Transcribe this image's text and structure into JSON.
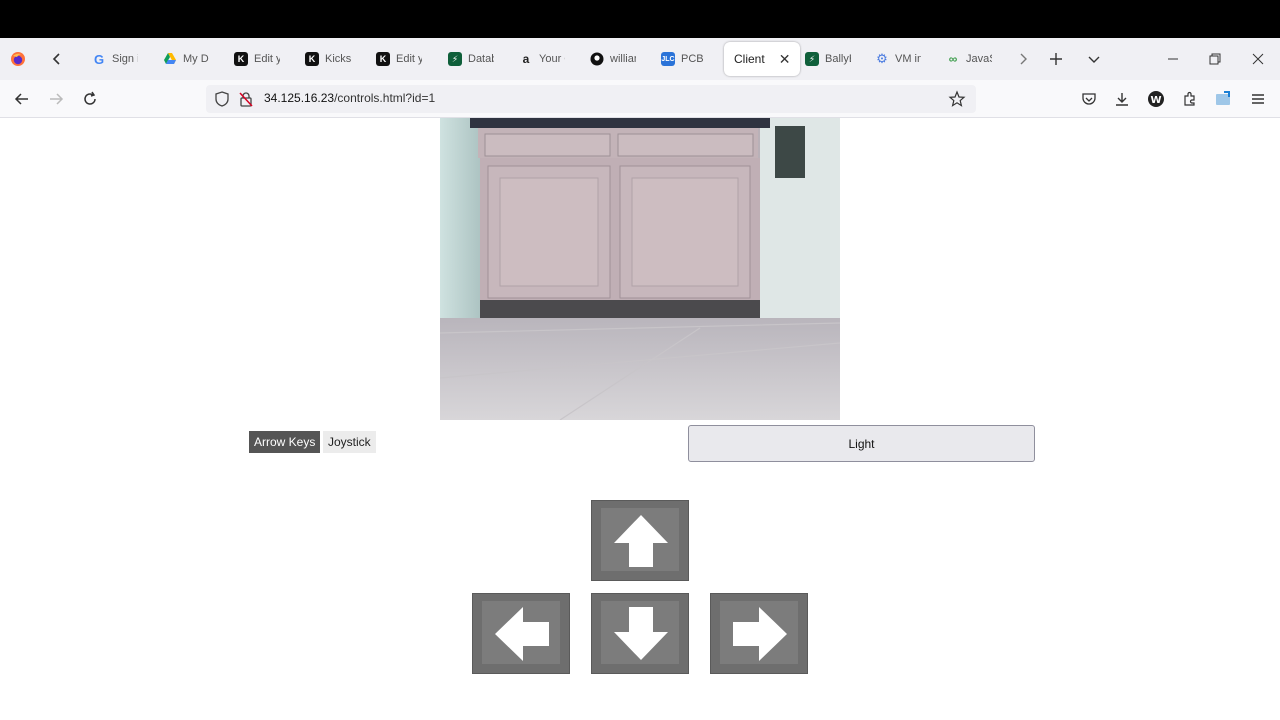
{
  "tabs": [
    {
      "label": "Sign i",
      "icon": "google-icon",
      "color": "#4285f4"
    },
    {
      "label": "My Dr",
      "icon": "google-drive-icon",
      "color": "#1fa463"
    },
    {
      "label": "Edit y",
      "icon": "kickstarter-icon",
      "color": "#111111"
    },
    {
      "label": "Kickst",
      "icon": "kickstarter-icon",
      "color": "#111111"
    },
    {
      "label": "Edit y",
      "icon": "kickstarter-icon",
      "color": "#111111"
    },
    {
      "label": "Datab",
      "icon": "database-icon",
      "color": "#0f5f3a"
    },
    {
      "label": "Your C",
      "icon": "amazon-icon",
      "color": "#ff9900"
    },
    {
      "label": "willian",
      "icon": "github-icon",
      "color": "#111111"
    },
    {
      "label": "PCB P",
      "icon": "jlc-icon",
      "color": "#2a73d8"
    },
    {
      "label": "Client",
      "icon": "",
      "color": "#ffffff",
      "active": true
    },
    {
      "label": "BallyE",
      "icon": "database-icon",
      "color": "#0f5f3a"
    },
    {
      "label": "VM in",
      "icon": "gear-icon",
      "color": "#4a7be0"
    },
    {
      "label": "JavaSc",
      "icon": "link-icon",
      "color": "#3b9c4a"
    }
  ],
  "active_tab_close": "✕",
  "url": {
    "host": "34.125.16.23",
    "path": "/controls.html?id=1"
  },
  "controls": {
    "mode_active": "Arrow Keys",
    "mode_inactive": "Joystick",
    "light": "Light"
  },
  "accent": "#555555"
}
